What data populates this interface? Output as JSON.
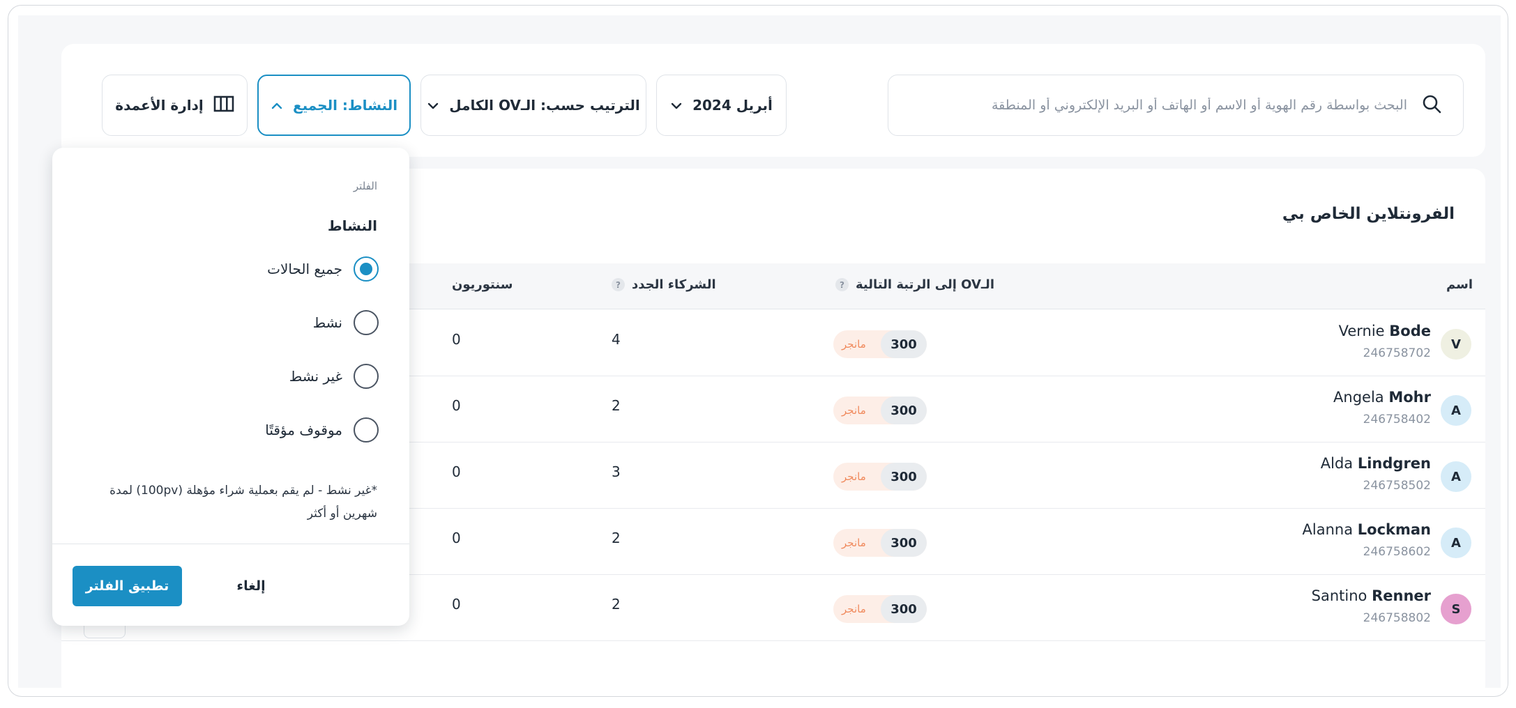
{
  "toolbar": {
    "search_placeholder": "البحث بواسطة رقم الهوية أو الاسم أو الهاتف أو البريد الإلكتروني أو المنطقة",
    "month_label": "أبريل 2024",
    "sort_label": "الترتيب حسب: الـOV الكامل",
    "activity_label": "النشاط: الجميع",
    "columns_label": "إدارة الأعمدة"
  },
  "table": {
    "title": "الفرونتلاين الخاص بي",
    "columns": {
      "name": "اسم",
      "ov_next": "الـOV إلى الرتبة التالية",
      "new_partners": "الشركاء الجدد",
      "centurions": "سنتوريون"
    },
    "help_glyph": "?",
    "rows": [
      {
        "initial": "V",
        "first": "Vernie",
        "last": "Bode",
        "id": "246758702",
        "ov": "300",
        "rank": "مانجر",
        "new_partners": "4",
        "centurions": "0",
        "avatar_color": "#eff0e2"
      },
      {
        "initial": "A",
        "first": "Angela",
        "last": "Mohr",
        "id": "246758402",
        "ov": "300",
        "rank": "مانجر",
        "new_partners": "2",
        "centurions": "0",
        "avatar_color": "#d6ecf8"
      },
      {
        "initial": "A",
        "first": "Alda",
        "last": "Lindgren",
        "id": "246758502",
        "ov": "300",
        "rank": "مانجر",
        "new_partners": "3",
        "centurions": "0",
        "avatar_color": "#d6ecf8"
      },
      {
        "initial": "A",
        "first": "Alanna",
        "last": "Lockman",
        "id": "246758602",
        "ov": "300",
        "rank": "مانجر",
        "new_partners": "2",
        "centurions": "0",
        "avatar_color": "#d6ecf8"
      },
      {
        "initial": "S",
        "first": "Santino",
        "last": "Renner",
        "id": "246758802",
        "ov": "300",
        "rank": "مانجر",
        "new_partners": "2",
        "centurions": "0",
        "avatar_color": "#e6a0cf"
      }
    ]
  },
  "filter": {
    "small_title": "الفلتر",
    "section": "النشاط",
    "options": [
      {
        "label": "جميع الحالات",
        "selected": true
      },
      {
        "label": "نشط",
        "selected": false
      },
      {
        "label": "غير نشط",
        "selected": false
      },
      {
        "label": "موقوف مؤقتًا",
        "selected": false
      }
    ],
    "note": "*غير نشط - لم يقم بعملية شراء مؤهلة (100pv) لمدة شهرين أو أكثر",
    "cancel_label": "إلغاء",
    "apply_label": "تطبيق الفلتر"
  },
  "colors": {
    "accent": "#1b8fc4",
    "rank_badge_bg": "#fdeee7",
    "rank_text": "#f08a5d"
  }
}
